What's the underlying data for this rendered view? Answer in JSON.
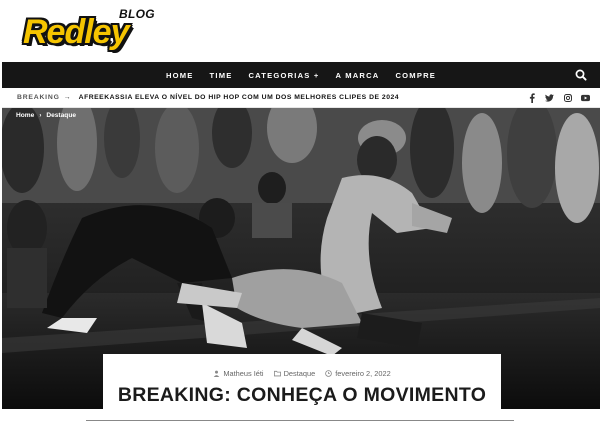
{
  "logo": {
    "brand": "Redley",
    "tag": "BLOG"
  },
  "nav": {
    "items": [
      "HOME",
      "TIME",
      "CATEGORIAS +",
      "A MARCA",
      "COMPRE"
    ],
    "search_icon": "search-icon"
  },
  "breaking": {
    "label": "BREAKING",
    "arrow": "→",
    "headline": "AFREEKASSIA ELEVA O NÍVEL DO HIP HOP COM UM DOS MELHORES CLIPES DE 2024"
  },
  "social": [
    "facebook-icon",
    "twitter-icon",
    "instagram-icon",
    "youtube-icon"
  ],
  "breadcrumb": {
    "home": "Home",
    "sep": "›",
    "current": "Destaque"
  },
  "post": {
    "author": "Matheus Iéti",
    "category": "Destaque",
    "date": "fevereiro 2, 2022",
    "title": "BREAKING: CONHEÇA O MOVIMENTO"
  },
  "colors": {
    "brand_yellow": "#f5c400",
    "nav_bg": "#161616",
    "text_dark": "#1b1b1b"
  }
}
